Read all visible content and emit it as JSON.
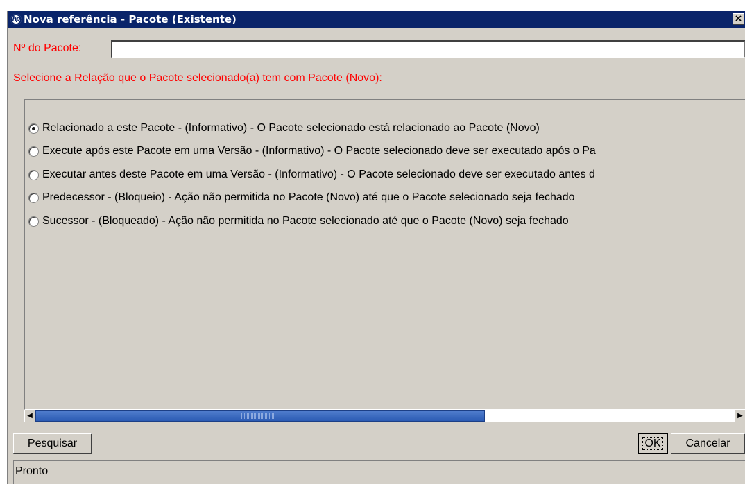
{
  "window": {
    "title": "Nova referência - Pacote (Existente)",
    "logo_text": "hp",
    "close_glyph": "×"
  },
  "form": {
    "package_number_label": "Nº do Pacote:",
    "package_number_value": "",
    "instruction": "Selecione a Relação que o Pacote selecionado(a) tem com Pacote (Novo):"
  },
  "relations": {
    "selected_index": 0,
    "options": [
      {
        "label": "Relacionado a este Pacote - (Informativo) - O Pacote selecionado está relacionado ao Pacote (Novo)",
        "checked": true
      },
      {
        "label": "Execute após este Pacote em uma Versão - (Informativo) - O Pacote selecionado deve ser executado após o Pa",
        "checked": false
      },
      {
        "label": "Executar antes deste Pacote em uma Versão - (Informativo) - O Pacote selecionado deve ser executado antes d",
        "checked": false
      },
      {
        "label": "Predecessor - (Bloqueio) - Ação não permitida no Pacote (Novo) até que o Pacote selecionado seja fechado",
        "checked": false
      },
      {
        "label": "Sucessor - (Bloqueado) - Ação não permitida no Pacote selecionado até que o Pacote (Novo) seja fechado",
        "checked": false
      }
    ]
  },
  "scrollbar": {
    "left_arrow": "◀",
    "right_arrow": "▶"
  },
  "buttons": {
    "search": "Pesquisar",
    "ok": "OK",
    "cancel": "Cancelar"
  },
  "status": {
    "text": "Pronto"
  },
  "colors": {
    "titlebar": "#0a246a",
    "label_red": "#ff0000",
    "dialog_bg": "#d4d0c8",
    "scroll_thumb": "#2b5bb3"
  }
}
